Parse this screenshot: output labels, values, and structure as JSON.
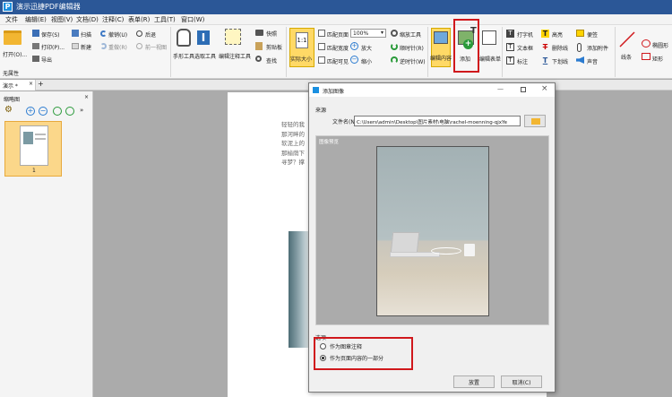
{
  "app": {
    "title": "演示迅捷PDF编辑器",
    "logo": "P"
  },
  "menu": [
    "文件",
    "编辑(E)",
    "视图(V)",
    "文档(D)",
    "注释(C)",
    "表单(R)",
    "工具(T)",
    "窗口(W)"
  ],
  "ribbon": {
    "open": "打开(O)...",
    "save": "保存(S)",
    "print": "打印(P)...",
    "export": "导出",
    "scan": "扫描",
    "new": "新建",
    "undo": "撤销(U)",
    "redo": "重做(R)",
    "back": "后退",
    "prev_view": "前一视图",
    "hand_tool": "手形工具",
    "select_tool": "选取工具",
    "edit_annot_tool": "编辑注释工具",
    "snapshot": "快照",
    "clipboard": "剪贴板",
    "find": "查找",
    "actual_size": "实际大小",
    "fit_page": "匹配页面",
    "fit_width": "匹配宽度",
    "fit_visible": "匹配可见",
    "zoom_value": "100%",
    "zoom_tool": "缩放工具",
    "zoom_in": "放大",
    "zoom_out": "缩小",
    "rotate_cw": "逆时针(W)",
    "rotate_ccw": "顺时针(R)",
    "edit_content": "编辑内容",
    "add": "添加",
    "edit_form": "编辑表单",
    "typewriter": "打字机",
    "textbox": "文本框",
    "callout": "标注",
    "highlight": "高亮",
    "strikeout": "删除线",
    "underline": "下划线",
    "note": "便签",
    "attach_file": "添加附件",
    "sound": "声音",
    "line": "线条",
    "ellipse": "椭圆形",
    "rect": "矩形",
    "no_properties": "无属性"
  },
  "tabs": {
    "doc_tab": "演示 *"
  },
  "left_panel": {
    "title": "缩略图",
    "page_number": "1"
  },
  "page_text": [
    "轻轻的我",
    "那河畔的",
    "软泥上的",
    "那榆荫下",
    "寻梦？撑"
  ],
  "dialog": {
    "title": "添加图像",
    "source_label": "来源",
    "file_label": "文件名(N):",
    "file_path": "C:\\Users\\admin\\Desktop\\图片素材\\电脑\\rachel-moenning-qjxYe",
    "preview_label": "图像预览",
    "options_label": "选项",
    "option_annotation": "作为图章注释",
    "option_content": "作为页面内容的一部分",
    "ok": "放置",
    "cancel": "取消(C)"
  },
  "colors": {
    "highlight": "#d0181c",
    "titlebar": "#2b5797",
    "accent": "#1a7fd0"
  }
}
